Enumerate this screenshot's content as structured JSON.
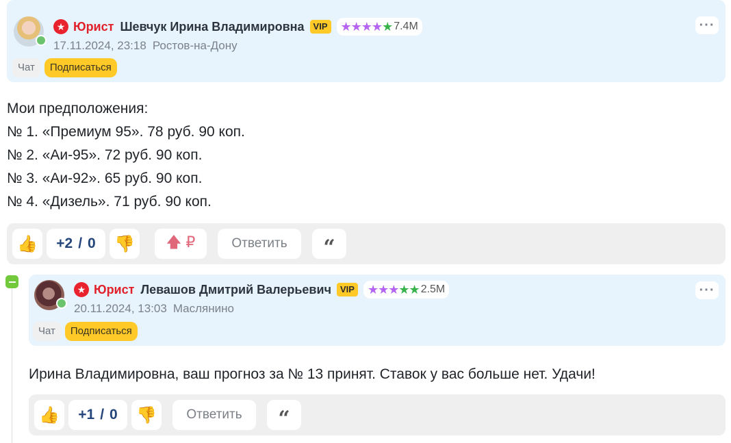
{
  "comments": [
    {
      "role": "Юрист",
      "author": "Шевчук Ирина Владимировна",
      "vip": "VIP",
      "rating": "7.4M",
      "stars": {
        "purple": 4,
        "green": 1
      },
      "date": "17.11.2024, 23:18",
      "location": "Ростов-на-Дону",
      "chat_label": "Чат",
      "subscribe_label": "Подписаться",
      "text_lines": [
        "Мои предположения:",
        "№ 1. «Премиум 95». 78 руб. 90 коп.",
        "№ 2. «Аи-95». 72 руб. 90 коп.",
        "№ 3. «Аи-92». 65 руб. 90 коп.",
        "№ 4. «Дизель». 71 руб. 90 коп."
      ],
      "score_up": "+2",
      "score_sep": "/",
      "score_down": "0",
      "reply_label": "Ответить"
    },
    {
      "role": "Юрист",
      "author": "Левашов Дмитрий Валерьевич",
      "vip": "VIP",
      "rating": "2.5M",
      "stars": {
        "purple": 3,
        "green": 2
      },
      "date": "20.11.2024, 13:03",
      "location": "Маслянино",
      "chat_label": "Чат",
      "subscribe_label": "Подписаться",
      "text": "Ирина Владимировна, ваш прогноз за № 13 принят. Ставок у вас больше нет. Удачи!",
      "score_up": "+1",
      "score_sep": "/",
      "score_down": "0",
      "reply_label": "Ответить"
    }
  ],
  "icons": {
    "badge": "red-star-badge-icon",
    "like": "thumbs-up-icon",
    "dislike": "thumbs-down-icon",
    "gift": "upvote-ruble-icon",
    "quote": "quote-icon",
    "more": "more-dots-icon",
    "collapse": "collapse-minus-icon"
  },
  "colors": {
    "header_bg": "#e7f4fd",
    "accent_yellow": "#ffc928",
    "role_red": "#e0202b",
    "score_blue": "#25467a",
    "star_purple": "#b464f0",
    "star_green": "#38b24a",
    "online_green": "#6cc36e"
  }
}
